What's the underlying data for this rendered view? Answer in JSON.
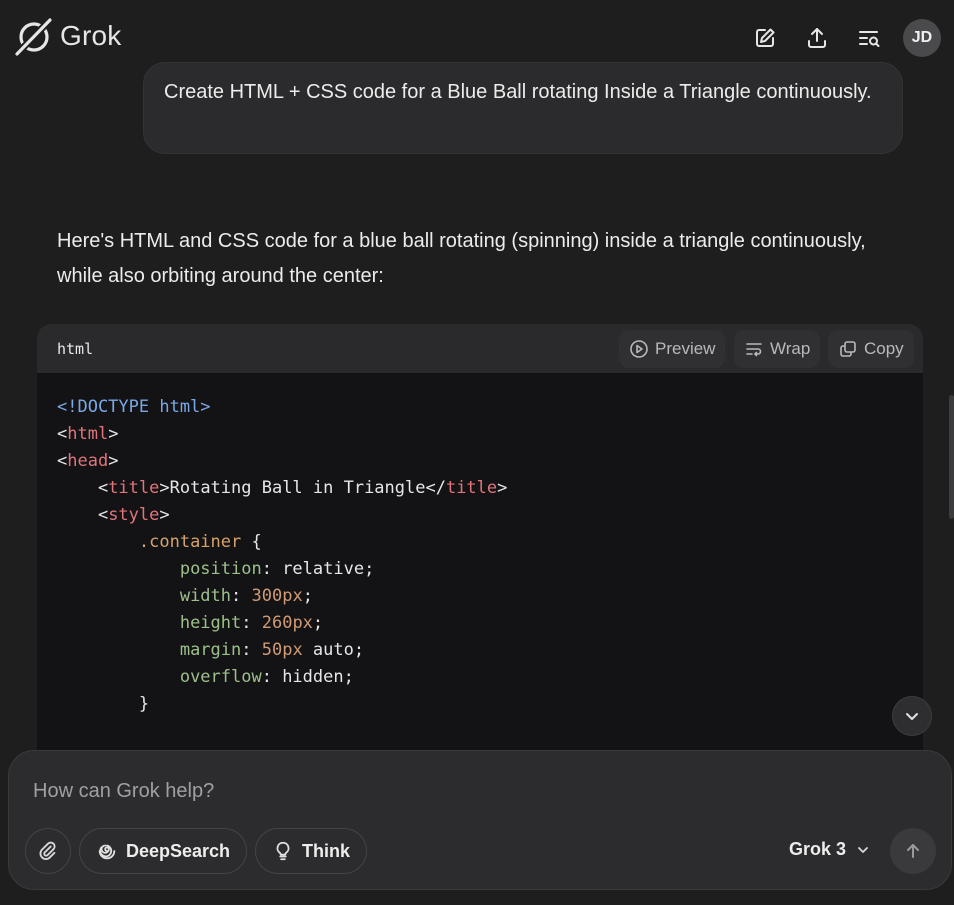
{
  "app": {
    "name": "Grok",
    "avatar_initials": "JD"
  },
  "header": {
    "icons": [
      "edit-icon",
      "share-icon",
      "history-search-icon"
    ]
  },
  "conversation": {
    "user_message": "Create HTML + CSS code for a Blue Ball rotating Inside a Triangle continuously.",
    "response_intro": "Here's HTML and CSS code for a blue ball rotating (spinning) inside a triangle continuously, while also orbiting around the center:"
  },
  "code_block": {
    "language": "html",
    "preview_label": "Preview",
    "wrap_label": "Wrap",
    "copy_label": "Copy",
    "lines": [
      {
        "parts": [
          {
            "t": "<!DOCTYPE html>",
            "c": "c-blue"
          }
        ]
      },
      {
        "parts": [
          {
            "t": "<",
            "c": ""
          },
          {
            "t": "html",
            "c": "c-red"
          },
          {
            "t": ">",
            "c": ""
          }
        ]
      },
      {
        "parts": [
          {
            "t": "<",
            "c": ""
          },
          {
            "t": "head",
            "c": "c-red"
          },
          {
            "t": ">",
            "c": ""
          }
        ]
      },
      {
        "parts": [
          {
            "t": "    <",
            "c": ""
          },
          {
            "t": "title",
            "c": "c-red"
          },
          {
            "t": ">Rotating Ball in Triangle</",
            "c": ""
          },
          {
            "t": "title",
            "c": "c-red"
          },
          {
            "t": ">",
            "c": ""
          }
        ]
      },
      {
        "parts": [
          {
            "t": "    <",
            "c": ""
          },
          {
            "t": "style",
            "c": "c-red"
          },
          {
            "t": ">",
            "c": ""
          }
        ]
      },
      {
        "parts": [
          {
            "t": "        ",
            "c": ""
          },
          {
            "t": ".container",
            "c": "c-orange"
          },
          {
            "t": " {",
            "c": ""
          }
        ]
      },
      {
        "parts": [
          {
            "t": "            ",
            "c": ""
          },
          {
            "t": "position",
            "c": "c-prop"
          },
          {
            "t": ": relative;",
            "c": ""
          }
        ]
      },
      {
        "parts": [
          {
            "t": "            ",
            "c": ""
          },
          {
            "t": "width",
            "c": "c-prop"
          },
          {
            "t": ": ",
            "c": ""
          },
          {
            "t": "300px",
            "c": "c-num"
          },
          {
            "t": ";",
            "c": ""
          }
        ]
      },
      {
        "parts": [
          {
            "t": "            ",
            "c": ""
          },
          {
            "t": "height",
            "c": "c-prop"
          },
          {
            "t": ": ",
            "c": ""
          },
          {
            "t": "260px",
            "c": "c-num"
          },
          {
            "t": ";",
            "c": ""
          }
        ]
      },
      {
        "parts": [
          {
            "t": "            ",
            "c": ""
          },
          {
            "t": "margin",
            "c": "c-prop"
          },
          {
            "t": ": ",
            "c": ""
          },
          {
            "t": "50px",
            "c": "c-num"
          },
          {
            "t": " auto;",
            "c": ""
          }
        ]
      },
      {
        "parts": [
          {
            "t": "            ",
            "c": ""
          },
          {
            "t": "overflow",
            "c": "c-prop"
          },
          {
            "t": ": hidden;",
            "c": ""
          }
        ]
      },
      {
        "parts": [
          {
            "t": "        }",
            "c": ""
          }
        ]
      }
    ]
  },
  "composer": {
    "placeholder": "How can Grok help?",
    "deepsearch_label": "DeepSearch",
    "think_label": "Think",
    "model_label": "Grok 3"
  },
  "colors": {
    "background": "#1e1e1f",
    "code_bg": "#131315",
    "bubble": "#2b2b2d"
  }
}
